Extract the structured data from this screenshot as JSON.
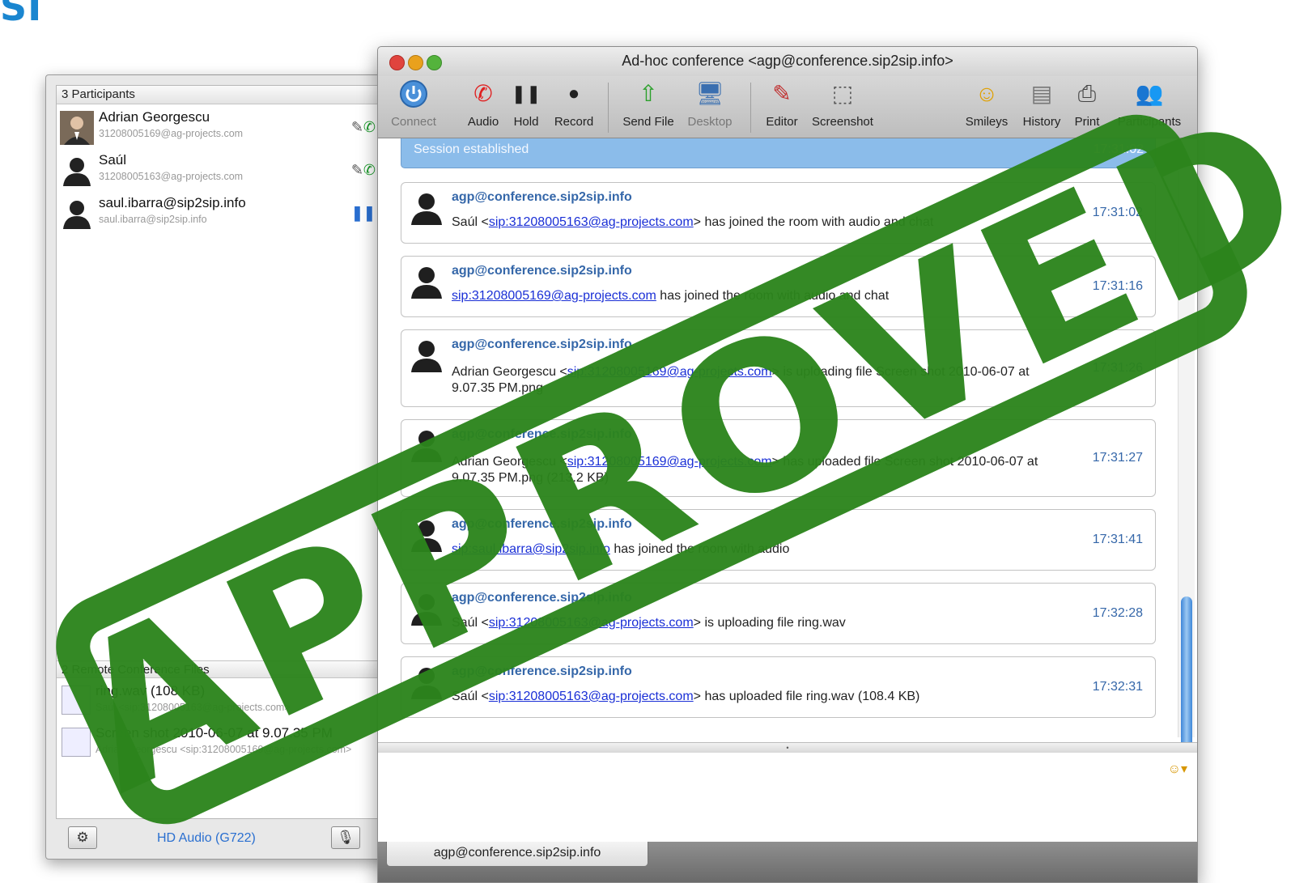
{
  "app_logo_fragment": "SI",
  "participants_panel": {
    "header": "3 Participants",
    "participants": [
      {
        "name": "Adrian Georgescu",
        "address": "31208005169@ag-projects.com",
        "state_icon": "pencil-and-phone-icon"
      },
      {
        "name": "Saúl",
        "address": "31208005163@ag-projects.com",
        "state_icon": "pencil-and-phone-icon"
      },
      {
        "name": "saul.ibarra@sip2sip.info",
        "address": "saul.ibarra@sip2sip.info",
        "state_icon": "hold-icon"
      }
    ],
    "files_header": "2 Remote Conference Files",
    "files": [
      {
        "name": "ring.wav (108 KB)",
        "sender": "Saúl <sip:31208005163@ag-projects.com>"
      },
      {
        "name": "Screen shot 2010-06-07 at 9.07.35 PM",
        "sender": "Adrian Georgescu <sip:31208005169@ag-projects.com>"
      }
    ],
    "codec": "HD Audio (G722)",
    "gear_icon": "gear-icon",
    "mic_icon": "microphone-mute-icon"
  },
  "window": {
    "title": "Ad-hoc conference <agp@conference.sip2sip.info>"
  },
  "toolbar": {
    "connect": "Connect",
    "audio": "Audio",
    "hold": "Hold",
    "record": "Record",
    "send_file": "Send File",
    "desktop": "Desktop",
    "editor": "Editor",
    "screenshot": "Screenshot",
    "smileys": "Smileys",
    "history": "History",
    "print": "Print",
    "participants": "Participants"
  },
  "session": {
    "status": "Session established",
    "time": "17:31:02"
  },
  "messages": [
    {
      "sender": "agp@conference.sip2sip.info",
      "pre": "Saúl <",
      "link": "sip:31208005163@ag-projects.com",
      "post": "> has joined the room with audio and chat",
      "time": "17:31:02"
    },
    {
      "sender": "agp@conference.sip2sip.info",
      "pre": "",
      "link": "sip:31208005169@ag-projects.com",
      "post": " has joined the room with audio and chat",
      "time": "17:31:16"
    },
    {
      "sender": "agp@conference.sip2sip.info",
      "pre": "Adrian Georgescu <",
      "link": "sip:31208005169@ag-projects.com",
      "post": "> is uploading file Screen shot 2010-06-07 at 9.07.35 PM.png",
      "time": "17:31:26"
    },
    {
      "sender": "agp@conference.sip2sip.info",
      "pre": "Adrian Georgescu <",
      "link": "sip:31208005169@ag-projects.com",
      "post": "> has uploaded file Screen shot 2010-06-07 at 9.07.35 PM.png (213.2 KB)",
      "time": "17:31:27"
    },
    {
      "sender": "agp@conference.sip2sip.info",
      "pre": "",
      "link": "sip:saul.ibarra@sip2sip.info",
      "post": " has joined the room with audio",
      "time": "17:31:41"
    },
    {
      "sender": "agp@conference.sip2sip.info",
      "pre": "Saúl <",
      "link": "sip:31208005163@ag-projects.com",
      "post": "> is uploading file ring.wav",
      "time": "17:32:28"
    },
    {
      "sender": "agp@conference.sip2sip.info",
      "pre": "Saúl <",
      "link": "sip:31208005163@ag-projects.com",
      "post": "> has uploaded file ring.wav (108.4 KB)",
      "time": "17:32:31"
    }
  ],
  "tab": {
    "label": "agp@conference.sip2sip.info"
  },
  "stamp": {
    "text": "APPROVED",
    "color": "#2c841c"
  }
}
